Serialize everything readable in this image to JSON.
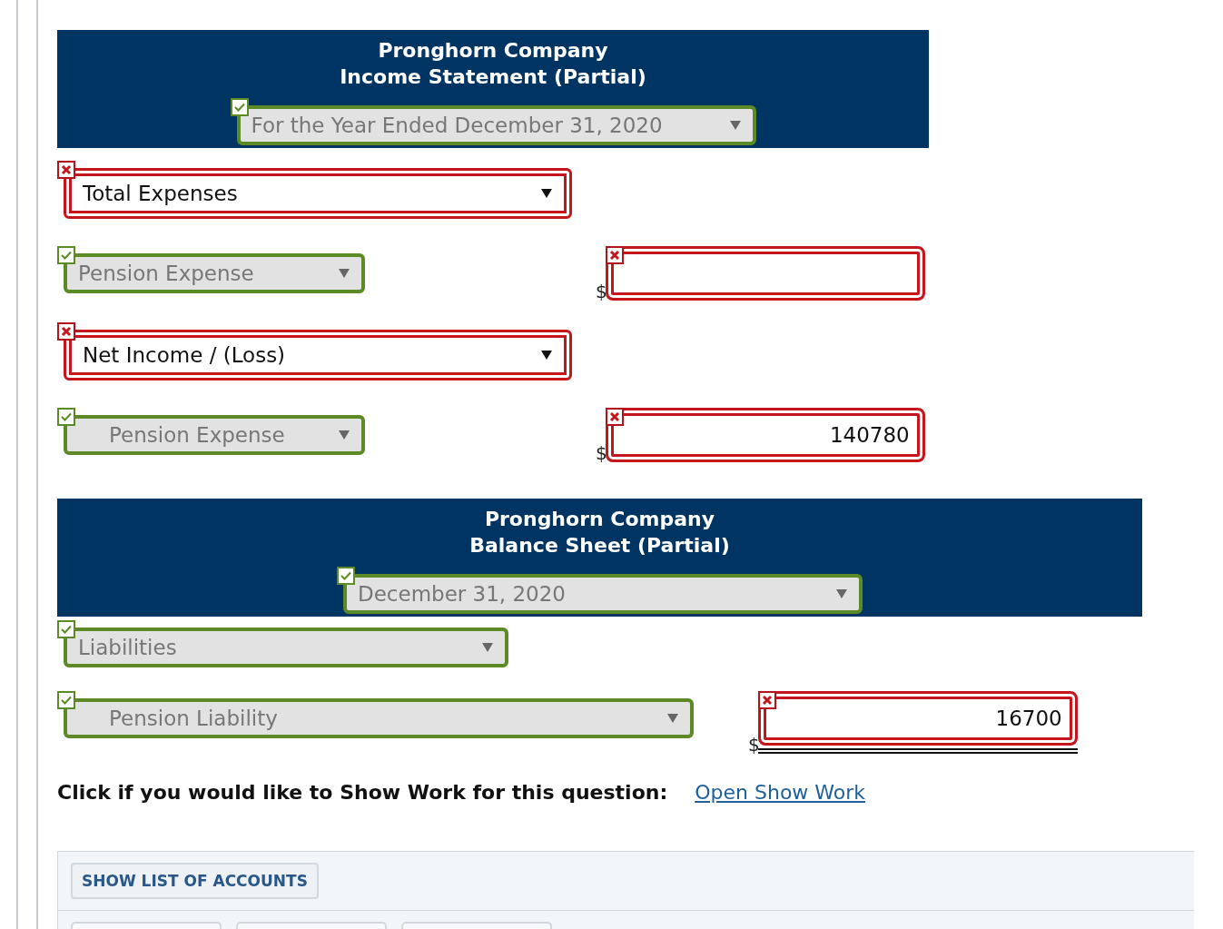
{
  "sections": [
    {
      "company": "Pronghorn Company",
      "statement": "Income Statement (Partial)",
      "period": {
        "value": "For the Year Ended December 31, 2020",
        "correct": true
      },
      "rows": [
        {
          "label": {
            "value": "Total Expenses",
            "correct": false,
            "indented": false
          }
        },
        {
          "label": {
            "value": "Pension Expense",
            "correct": true,
            "indented": false
          },
          "amount": {
            "correct": false,
            "double_underline": false
          }
        },
        {
          "label": {
            "value": "Net Income / (Loss)",
            "correct": false,
            "indented": false
          }
        },
        {
          "label": {
            "value": "Pension Expense",
            "correct": true,
            "indented": true
          },
          "amount": {
            "value": "140780",
            "correct": false,
            "double_underline": false
          }
        }
      ]
    },
    {
      "company": "Pronghorn Company",
      "statement": "Balance Sheet (Partial)",
      "period": {
        "value": "December 31, 2020",
        "correct": true
      },
      "rows": [
        {
          "label": {
            "value": "Liabilities",
            "correct": true,
            "indented": false
          }
        },
        {
          "label": {
            "value": "Pension Liability",
            "correct": true,
            "indented": true
          },
          "amount": {
            "value": "16700",
            "correct": false,
            "double_underline": true
          }
        }
      ]
    }
  ],
  "currency_symbol": "$",
  "show_work": {
    "prompt": "Click if you would like to Show Work for this question:",
    "link": "Open Show Work"
  },
  "accounts_button": "SHOW LIST OF ACCOUNTS"
}
